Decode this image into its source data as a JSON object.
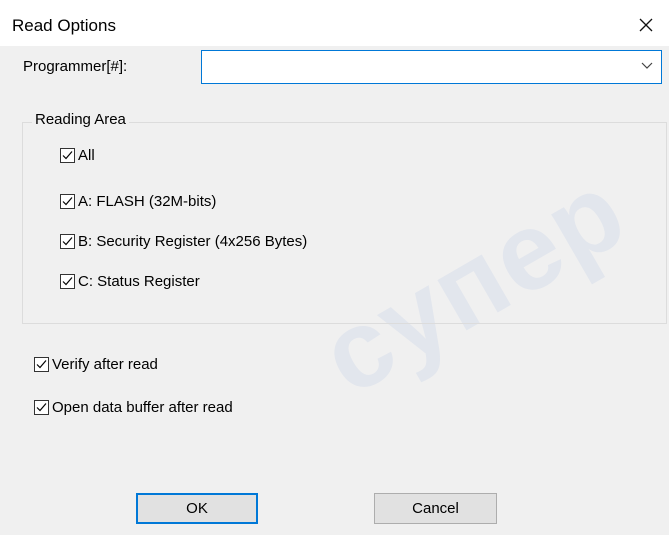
{
  "window": {
    "title": "Read Options"
  },
  "programmer": {
    "label": "Programmer[#]:",
    "value": ""
  },
  "reading_area": {
    "legend": "Reading Area",
    "items": [
      {
        "label": "All",
        "checked": true
      },
      {
        "label": "A: FLASH (32M-bits)",
        "checked": true
      },
      {
        "label": "B: Security Register (4x256 Bytes)",
        "checked": true
      },
      {
        "label": "C: Status Register",
        "checked": true
      }
    ]
  },
  "options": {
    "verify": {
      "label": "Verify after read",
      "checked": true
    },
    "open_buffer": {
      "label": "Open data buffer after read",
      "checked": true
    }
  },
  "buttons": {
    "ok": "OK",
    "cancel": "Cancel"
  },
  "watermark": "супер",
  "colors": {
    "accent": "#0078d7",
    "background": "#f0f0f0"
  }
}
